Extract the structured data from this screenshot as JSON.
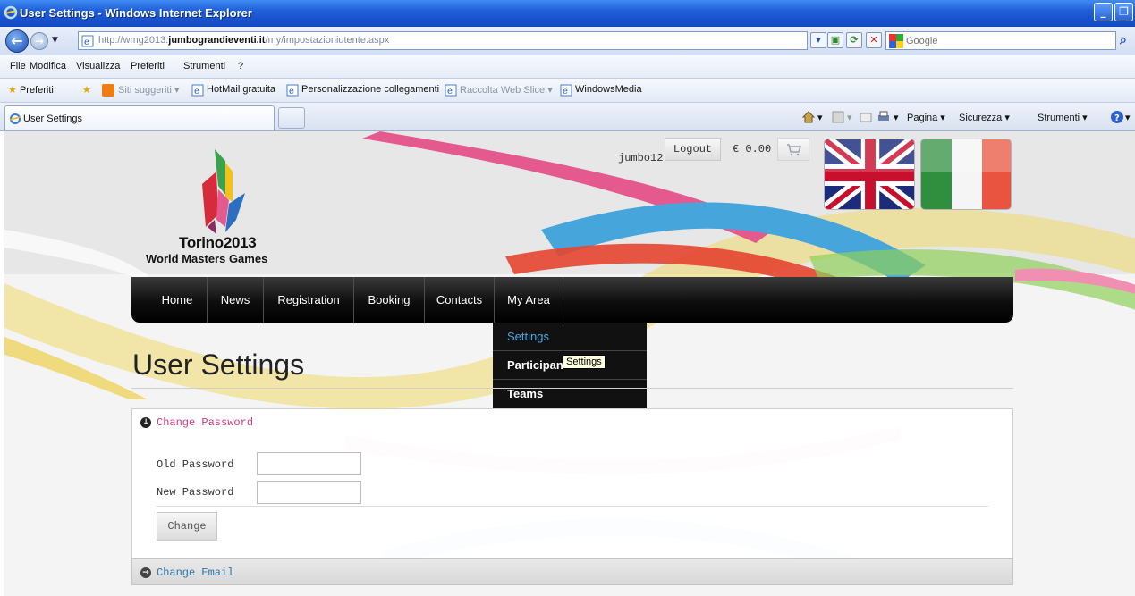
{
  "window": {
    "title": "User Settings - Windows Internet Explorer"
  },
  "address": {
    "url_prefix": "http://wmg2013.",
    "url_host": "jumbograndieventi.it",
    "url_path": "/my/impostazioniutente.aspx",
    "search_placeholder": "Google"
  },
  "menubar": [
    "File",
    "Modifica",
    "Visualizza",
    "Preferiti",
    "Strumenti",
    "?"
  ],
  "favorites": {
    "label": "Preferiti",
    "items": [
      "Siti suggeriti ▾",
      "HotMail gratuita",
      "Personalizzazione collegamenti",
      "Raccolta Web Slice ▾",
      "WindowsMedia"
    ]
  },
  "tabs": {
    "active": "User Settings"
  },
  "commandbar": {
    "page": "Pagina ▾",
    "security": "Sicurezza ▾",
    "tools": "Strumenti ▾"
  },
  "site": {
    "logo_line1": "Torino2013",
    "logo_line2": "World Masters Games",
    "username": "jumbo12",
    "logout": "Logout",
    "cart_total": "€ 0.00",
    "nav": [
      "Home",
      "News",
      "Registration",
      "Booking",
      "Contacts",
      "My Area"
    ],
    "dropdown": [
      "Settings",
      "Participants",
      "Teams"
    ],
    "tooltip": "Settings",
    "page_title": "User Settings",
    "password_panel": {
      "title": "Change Password",
      "old_label": "Old Password",
      "new_label": "New Password",
      "button": "Change"
    },
    "email_panel": {
      "title": "Change Email"
    }
  },
  "colors": {
    "accent_pink": "#d3367a",
    "link_blue": "#2e75a6",
    "menu_active": "#4aa6df"
  }
}
